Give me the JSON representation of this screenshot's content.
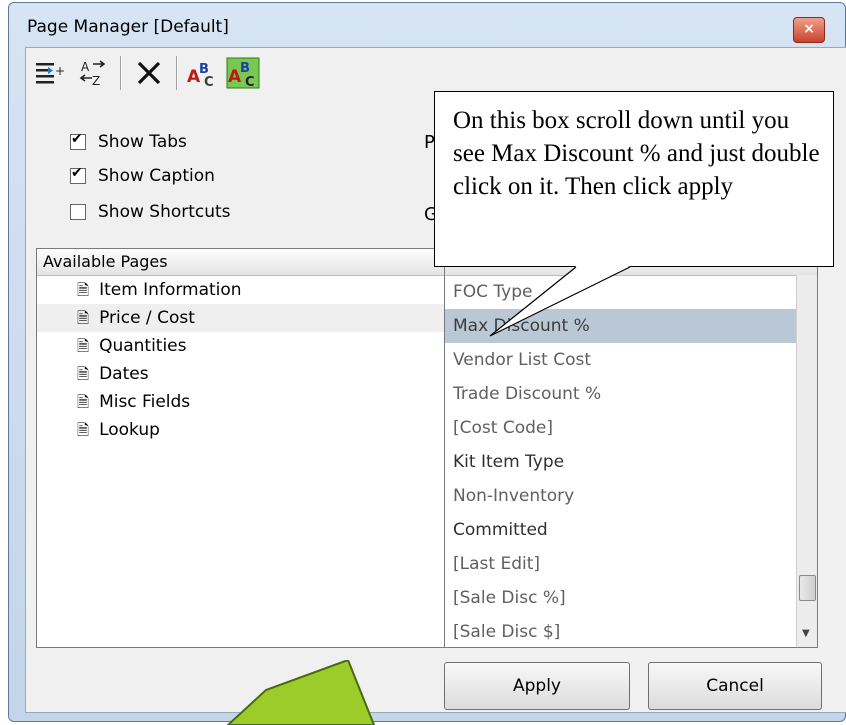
{
  "window": {
    "title": "Page Manager [Default]",
    "close_glyph": "×"
  },
  "toolbar": {
    "icons": [
      "insert-page-icon",
      "sort-az-icon",
      "delete-icon",
      "rename-icon",
      "spellcheck-icon"
    ]
  },
  "options": [
    {
      "label": "Show Tabs",
      "checked": true
    },
    {
      "label": "Show Caption",
      "checked": true
    },
    {
      "label": "Show Shortcuts",
      "checked": false
    }
  ],
  "side_letters": [
    "P",
    "G"
  ],
  "available_pages": {
    "header": "Available Pages",
    "items": [
      "Item Information",
      "Price / Cost",
      "Quantities",
      "Dates",
      "Misc Fields",
      "Lookup"
    ],
    "selected_index": 1
  },
  "fields_list": {
    "items": [
      "FOC Type",
      "Max Discount %",
      "Vendor List Cost",
      "Trade Discount %",
      "[Cost Code]",
      "Kit Item Type",
      "Non-Inventory",
      "Committed",
      "[Last Edit]",
      "[Sale Disc %]",
      "[Sale Disc $]"
    ],
    "selected_index": 1
  },
  "buttons": {
    "apply": "Apply",
    "cancel": "Cancel"
  },
  "callout": {
    "text": "On this box scroll down until you see Max Discount % and just double click on it. Then click apply"
  },
  "colors": {
    "selection": "#bac8d6",
    "arrow_green": "#9ccc2a",
    "title_gradient": "#d6e4f3"
  }
}
